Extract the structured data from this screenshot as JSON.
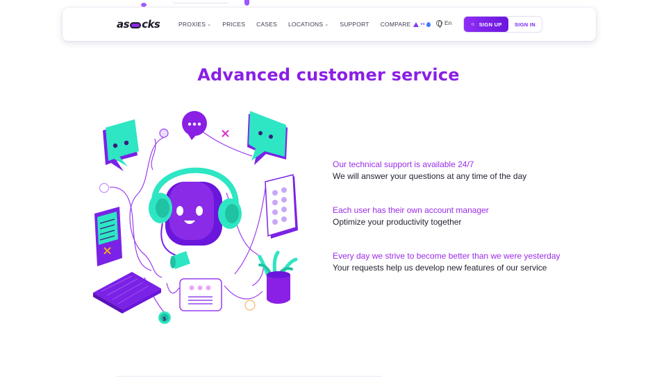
{
  "header": {
    "logo_left": "as",
    "logo_right": "cks",
    "nav": [
      {
        "label": "PROXIES",
        "has_dropdown": true
      },
      {
        "label": "PRICES",
        "has_dropdown": false
      },
      {
        "label": "CASES",
        "has_dropdown": false
      },
      {
        "label": "LOCATIONS",
        "has_dropdown": true
      },
      {
        "label": "SUPPORT",
        "has_dropdown": false
      },
      {
        "label": "COMPARE",
        "has_dropdown": false
      }
    ],
    "compare_vs": "vs",
    "language": "En",
    "signup_label": "SIGN UP",
    "signin_label": "SIGN IN"
  },
  "section": {
    "title": "Advanced customer service",
    "features": [
      {
        "heading": "Our technical support is available 24/7",
        "text": "We will answer your questions at any time of the day"
      },
      {
        "heading": "Each user has their own account manager",
        "text": "Optimize your productivity together"
      },
      {
        "heading": "Every day we strive to become better than we were yesterday",
        "text": "Your requests help us develop new features of our service"
      }
    ]
  },
  "colors": {
    "brand_purple": "#8a1fe6",
    "accent_teal": "#2ee6c3",
    "text_dark": "#232333"
  },
  "icons": [
    "chevron-down-icon",
    "globe-icon",
    "user-icon",
    "triangle-logo-icon",
    "drop-logo-icon"
  ]
}
